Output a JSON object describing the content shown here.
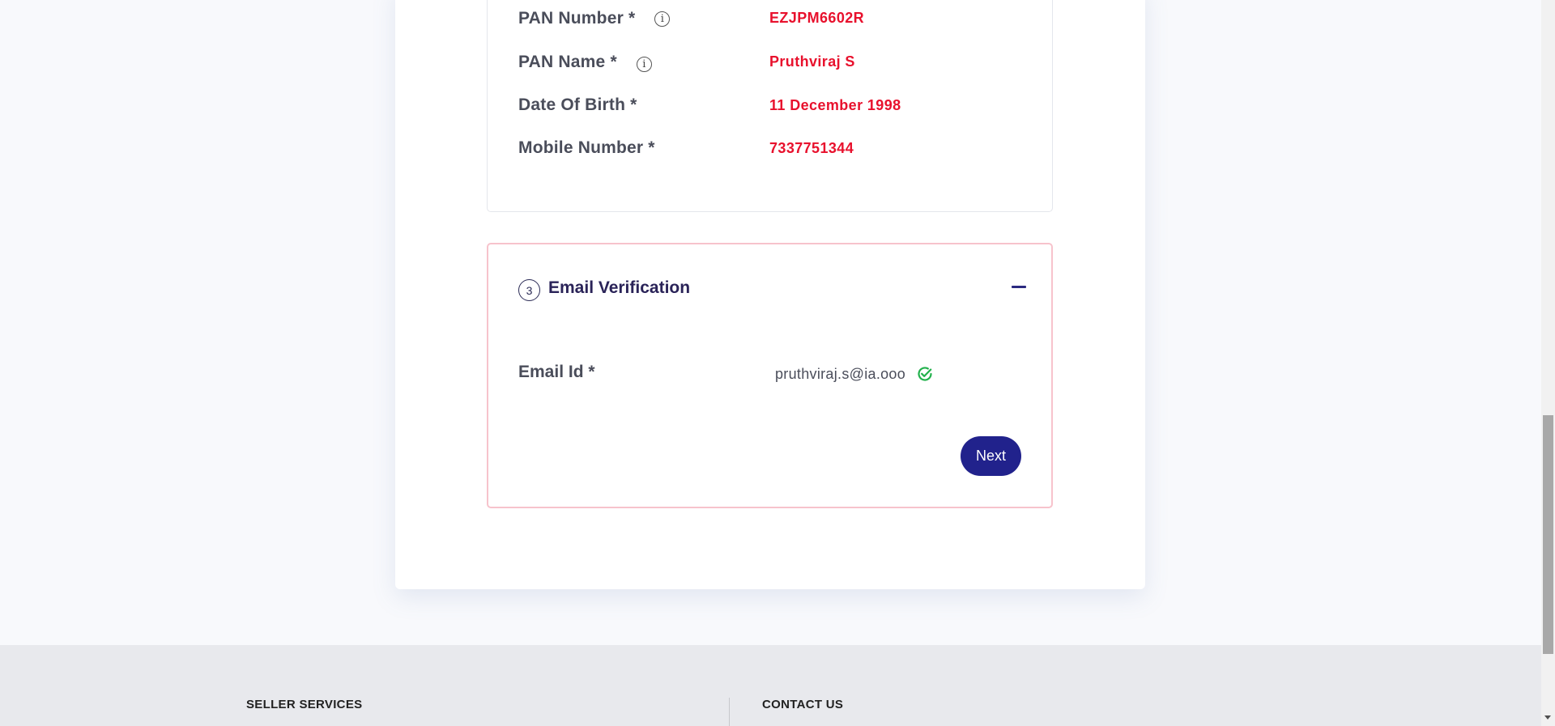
{
  "pan_details": {
    "rows": [
      {
        "label": "PAN Number *",
        "value": "EZJPM6602R",
        "has_info": true
      },
      {
        "label": "PAN Name *",
        "value": "Pruthviraj S",
        "has_info": true
      },
      {
        "label": "Date Of Birth *",
        "value": "11 December 1998",
        "has_info": false
      },
      {
        "label": "Mobile Number *",
        "value": "7337751344",
        "has_info": false
      }
    ],
    "info_glyph": "i"
  },
  "email_section": {
    "step_number": "3",
    "title": "Email Verification",
    "email_label": "Email Id *",
    "email_value": "pruthviraj.s@ia.ooo",
    "verified_icon": "check-circle-icon",
    "next_label": "Next"
  },
  "footer": {
    "seller_services": "SELLER SERVICES",
    "contact_us": "CONTACT US"
  },
  "colors": {
    "accent": "#21228c",
    "value_red": "#e8112d",
    "verified_green": "#22b14c",
    "active_border": "#f7c3cc"
  }
}
